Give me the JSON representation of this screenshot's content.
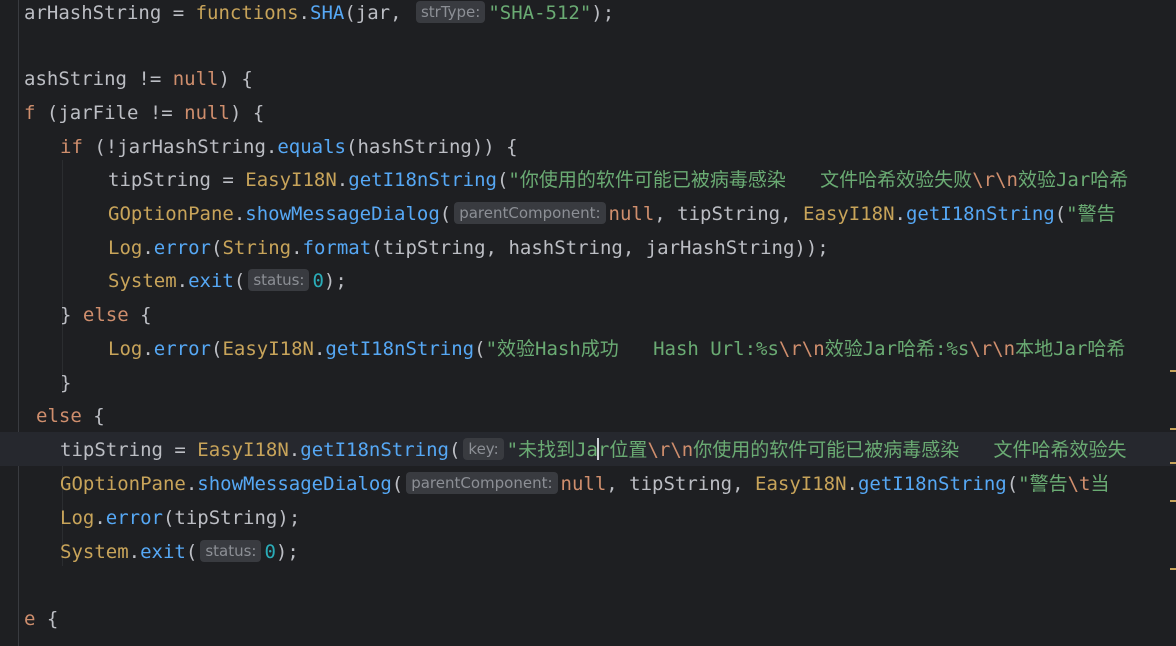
{
  "editor": {
    "lines": [
      {
        "id": "l1",
        "tokens": [
          {
            "t": "arHashString = ",
            "c": "plain"
          },
          {
            "t": "functions",
            "c": "cls"
          },
          {
            "t": ".",
            "c": "plain"
          },
          {
            "t": "SHA",
            "c": "fn"
          },
          {
            "t": "(jar, ",
            "c": "plain"
          },
          {
            "h": "strType:"
          },
          {
            "t": "\"SHA-512\"",
            "c": "str"
          },
          {
            "t": ");",
            "c": "plain"
          }
        ]
      },
      {
        "id": "l2",
        "tokens": []
      },
      {
        "id": "l3",
        "tokens": [
          {
            "t": "ashString != ",
            "c": "plain"
          },
          {
            "t": "null",
            "c": "kw"
          },
          {
            "t": ") {",
            "c": "plain"
          }
        ]
      },
      {
        "id": "l4",
        "tokens": [
          {
            "t": "f",
            "c": "kw"
          },
          {
            "t": " (jarFile != ",
            "c": "plain"
          },
          {
            "t": "null",
            "c": "kw"
          },
          {
            "t": ") {",
            "c": "plain"
          }
        ]
      },
      {
        "id": "l5",
        "tokens": [
          {
            "t": "if",
            "c": "kw"
          },
          {
            "t": " (!jarHashString.",
            "c": "plain"
          },
          {
            "t": "equals",
            "c": "fn"
          },
          {
            "t": "(hashString)) {",
            "c": "plain"
          }
        ]
      },
      {
        "id": "l6",
        "tokens": [
          {
            "t": "tipString = ",
            "c": "plain"
          },
          {
            "t": "EasyI18N",
            "c": "cls"
          },
          {
            "t": ".",
            "c": "plain"
          },
          {
            "t": "getI18nString",
            "c": "fn"
          },
          {
            "t": "(",
            "c": "plain"
          },
          {
            "t": "\"你使用的软件可能已被病毒感染   文件哈希效验失败",
            "c": "str"
          },
          {
            "t": "\\r\\n",
            "c": "esc"
          },
          {
            "t": "效验Jar哈希",
            "c": "str"
          }
        ]
      },
      {
        "id": "l7",
        "tokens": [
          {
            "t": "GOptionPane",
            "c": "cls"
          },
          {
            "t": ".",
            "c": "plain"
          },
          {
            "t": "showMessageDialog",
            "c": "fn"
          },
          {
            "t": "(",
            "c": "plain"
          },
          {
            "h": "parentComponent:"
          },
          {
            "t": "null",
            "c": "kw"
          },
          {
            "t": ", tipString, ",
            "c": "plain"
          },
          {
            "t": "EasyI18N",
            "c": "cls"
          },
          {
            "t": ".",
            "c": "plain"
          },
          {
            "t": "getI18nString",
            "c": "fn"
          },
          {
            "t": "(",
            "c": "plain"
          },
          {
            "t": "\"警告",
            "c": "str"
          }
        ]
      },
      {
        "id": "l8",
        "tokens": [
          {
            "t": "Log",
            "c": "cls"
          },
          {
            "t": ".",
            "c": "plain"
          },
          {
            "t": "error",
            "c": "fn"
          },
          {
            "t": "(",
            "c": "plain"
          },
          {
            "t": "String",
            "c": "cls"
          },
          {
            "t": ".",
            "c": "plain"
          },
          {
            "t": "format",
            "c": "fn"
          },
          {
            "t": "(tipString, hashString, jarHashString));",
            "c": "plain"
          }
        ]
      },
      {
        "id": "l9",
        "tokens": [
          {
            "t": "System",
            "c": "cls"
          },
          {
            "t": ".",
            "c": "plain"
          },
          {
            "t": "exit",
            "c": "fn"
          },
          {
            "t": "(",
            "c": "plain"
          },
          {
            "h": "status:"
          },
          {
            "t": "0",
            "c": "num"
          },
          {
            "t": ");",
            "c": "plain"
          }
        ]
      },
      {
        "id": "l10",
        "tokens": [
          {
            "t": "} ",
            "c": "plain"
          },
          {
            "t": "else",
            "c": "kw"
          },
          {
            "t": " {",
            "c": "plain"
          }
        ]
      },
      {
        "id": "l11",
        "tokens": [
          {
            "t": "Log",
            "c": "cls"
          },
          {
            "t": ".",
            "c": "plain"
          },
          {
            "t": "error",
            "c": "fn"
          },
          {
            "t": "(",
            "c": "plain"
          },
          {
            "t": "EasyI18N",
            "c": "cls"
          },
          {
            "t": ".",
            "c": "plain"
          },
          {
            "t": "getI18nString",
            "c": "fn"
          },
          {
            "t": "(",
            "c": "plain"
          },
          {
            "t": "\"效验Hash成功   Hash Url:%s",
            "c": "str"
          },
          {
            "t": "\\r\\n",
            "c": "esc"
          },
          {
            "t": "效验Jar哈希:%s",
            "c": "str"
          },
          {
            "t": "\\r\\n",
            "c": "esc"
          },
          {
            "t": "本地Jar哈希",
            "c": "str"
          }
        ]
      },
      {
        "id": "l12",
        "tokens": [
          {
            "t": "}",
            "c": "plain"
          }
        ]
      },
      {
        "id": "l13",
        "tokens": [
          {
            "t": "else",
            "c": "kw"
          },
          {
            "t": " {",
            "c": "plain"
          }
        ]
      },
      {
        "id": "l14",
        "tokens": [
          {
            "t": "tipString = ",
            "c": "plain"
          },
          {
            "t": "EasyI18N",
            "c": "cls"
          },
          {
            "t": ".",
            "c": "plain"
          },
          {
            "t": "getI18nString",
            "c": "fn"
          },
          {
            "t": "(",
            "c": "plain"
          },
          {
            "h": "key:"
          },
          {
            "t": "\"未找到Ja",
            "c": "str"
          },
          {
            "caret": true
          },
          {
            "t": "r位置",
            "c": "str"
          },
          {
            "t": "\\r\\n",
            "c": "esc"
          },
          {
            "t": "你使用的软件可能已被病毒感染   文件哈希效验失",
            "c": "str"
          }
        ]
      },
      {
        "id": "l15",
        "tokens": [
          {
            "t": "GOptionPane",
            "c": "cls"
          },
          {
            "t": ".",
            "c": "plain"
          },
          {
            "t": "showMessageDialog",
            "c": "fn"
          },
          {
            "t": "(",
            "c": "plain"
          },
          {
            "h": "parentComponent:"
          },
          {
            "t": "null",
            "c": "kw"
          },
          {
            "t": ", tipString, ",
            "c": "plain"
          },
          {
            "t": "EasyI18N",
            "c": "cls"
          },
          {
            "t": ".",
            "c": "plain"
          },
          {
            "t": "getI18nString",
            "c": "fn"
          },
          {
            "t": "(",
            "c": "plain"
          },
          {
            "t": "\"警告",
            "c": "str"
          },
          {
            "t": "\\t",
            "c": "esc"
          },
          {
            "t": "当",
            "c": "str"
          }
        ]
      },
      {
        "id": "l16",
        "tokens": [
          {
            "t": "Log",
            "c": "cls"
          },
          {
            "t": ".",
            "c": "plain"
          },
          {
            "t": "error",
            "c": "fn"
          },
          {
            "t": "(tipString);",
            "c": "plain"
          }
        ]
      },
      {
        "id": "l17",
        "tokens": [
          {
            "t": "System",
            "c": "cls"
          },
          {
            "t": ".",
            "c": "plain"
          },
          {
            "t": "exit",
            "c": "fn"
          },
          {
            "t": "(",
            "c": "plain"
          },
          {
            "h": "status:"
          },
          {
            "t": "0",
            "c": "num"
          },
          {
            "t": ");",
            "c": "plain"
          }
        ]
      },
      {
        "id": "l18",
        "tokens": []
      },
      {
        "id": "l19",
        "tokens": [
          {
            "t": "e",
            "c": "kw"
          },
          {
            "t": " {",
            "c": "plain"
          }
        ]
      }
    ]
  }
}
